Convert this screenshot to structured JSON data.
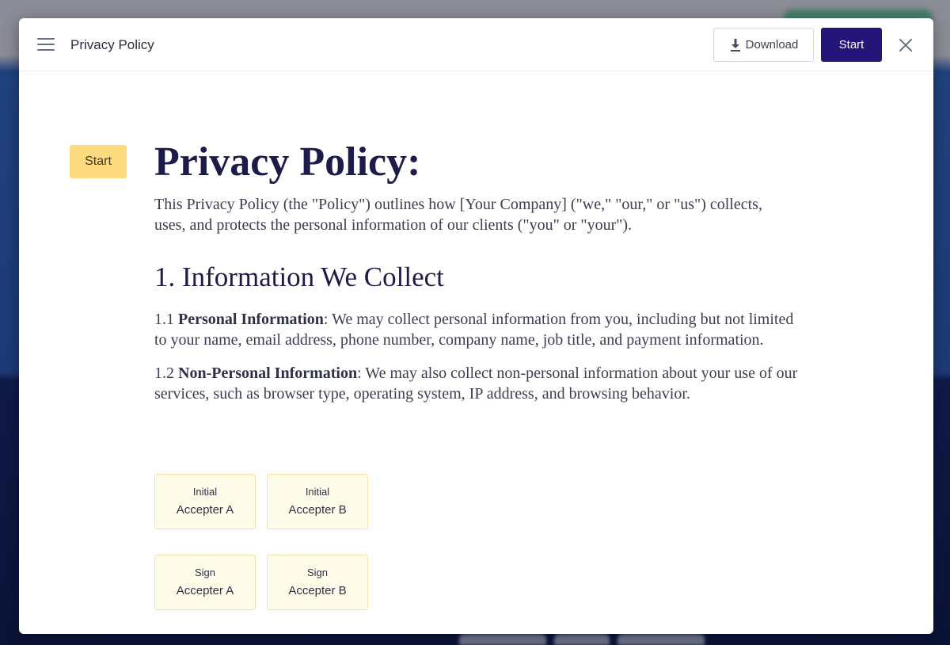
{
  "header": {
    "title": "Privacy Policy",
    "download_label": "Download",
    "start_label": "Start"
  },
  "content": {
    "start_tag": "Start",
    "title": "Privacy Policy:",
    "intro": "This Privacy Policy (the \"Policy\") outlines how [Your Company] (\"we,\" \"our,\" or \"us\") collects, uses, and protects the personal information of our clients (\"you\" or \"your\").",
    "section_heading": "1. Information We Collect",
    "paragraphs": [
      {
        "number": "1.1",
        "term": "Personal Information",
        "text": ": We may collect personal information from you, including but not limited to your name, email address, phone number, company name, job title, and payment information."
      },
      {
        "number": "1.2",
        "term": "Non-Personal Information",
        "text": ": We may also collect non-personal information about your use of our services, such as browser type, operating system, IP address, and browsing behavior."
      }
    ]
  },
  "fields": [
    {
      "type": "Initial",
      "signer": "Accepter A"
    },
    {
      "type": "Initial",
      "signer": "Accepter B"
    },
    {
      "type": "Sign",
      "signer": "Accepter A"
    },
    {
      "type": "Sign",
      "signer": "Accepter B"
    }
  ],
  "icons": {
    "menu": "hamburger-menu-icon",
    "download": "download-icon",
    "close": "close-icon"
  },
  "colors": {
    "primary_button": "#23157a",
    "start_tag": "#fdd97f",
    "field_background": "#fffbe9",
    "heading_text": "#1d1b4a"
  }
}
